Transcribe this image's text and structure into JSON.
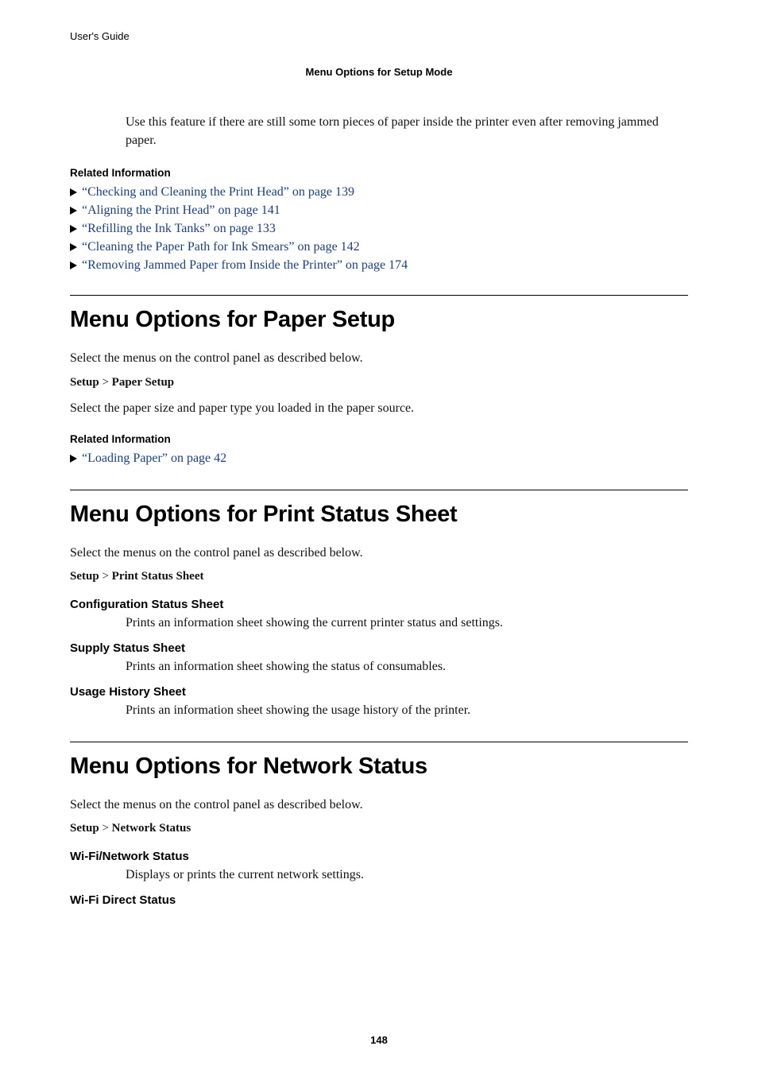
{
  "header": {
    "guide_label": "User's Guide",
    "sub_title": "Menu Options for Setup Mode"
  },
  "intro_feature_text": "Use this feature if there are still some torn pieces of paper inside the printer even after removing jammed paper.",
  "related_info_label": "Related Information",
  "related_links_1": [
    "“Checking and Cleaning the Print Head” on page 139",
    "“Aligning the Print Head” on page 141",
    "“Refilling the Ink Tanks” on page 133",
    "“Cleaning the Paper Path for Ink Smears” on page 142",
    "“Removing Jammed Paper from Inside the Printer” on page 174"
  ],
  "section_paper_setup": {
    "title": "Menu Options for Paper Setup",
    "desc": "Select the menus on the control panel as described below.",
    "crumb_prefix": "Setup",
    "crumb_sep": " > ",
    "crumb_item": "Paper Setup",
    "body2": "Select the paper size and paper type you loaded in the paper source.",
    "related_links": [
      "“Loading Paper” on page 42"
    ]
  },
  "section_print_status": {
    "title": "Menu Options for Print Status Sheet",
    "desc": "Select the menus on the control panel as described below.",
    "crumb_prefix": "Setup",
    "crumb_sep": " > ",
    "crumb_item": "Print Status Sheet",
    "items": [
      {
        "label": "Configuration Status Sheet",
        "desc": "Prints an information sheet showing the current printer status and settings."
      },
      {
        "label": "Supply Status Sheet",
        "desc": "Prints an information sheet showing the status of consumables."
      },
      {
        "label": "Usage History Sheet",
        "desc": "Prints an information sheet showing the usage history of the printer."
      }
    ]
  },
  "section_network_status": {
    "title": "Menu Options for Network Status",
    "desc": "Select the menus on the control panel as described below.",
    "crumb_prefix": "Setup",
    "crumb_sep": " > ",
    "crumb_item": "Network Status",
    "items": [
      {
        "label": "Wi-Fi/Network Status",
        "desc": "Displays or prints the current network settings."
      },
      {
        "label": "Wi-Fi Direct Status",
        "desc": ""
      }
    ]
  },
  "page_number": "148"
}
